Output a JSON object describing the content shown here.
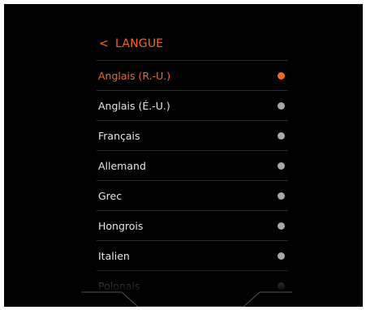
{
  "header": {
    "back_icon": "chevron-left-icon",
    "back_glyph": "<",
    "title": "LANGUE"
  },
  "languages": [
    {
      "label": "Anglais (R.-U.)",
      "selected": true
    },
    {
      "label": "Anglais (É.-U.)",
      "selected": false
    },
    {
      "label": "Français",
      "selected": false
    },
    {
      "label": "Allemand",
      "selected": false
    },
    {
      "label": "Grec",
      "selected": false
    },
    {
      "label": "Hongrois",
      "selected": false
    },
    {
      "label": "Italien",
      "selected": false
    },
    {
      "label": "Polonais",
      "selected": false
    }
  ],
  "colors": {
    "accent": "#f26a21",
    "background": "#000000",
    "text": "#e8e8e8",
    "radio_inactive": "#a7a7a7",
    "divider": "#2a2a2a"
  }
}
